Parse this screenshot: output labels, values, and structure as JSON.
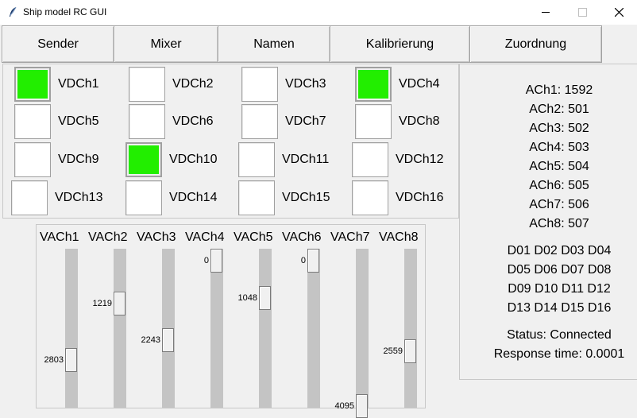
{
  "window": {
    "title": "Ship model RC GUI",
    "min": "—",
    "max": "☐",
    "close": "✕"
  },
  "menu": [
    "Sender",
    "Mixer",
    "Namen",
    "Kalibrierung",
    "Zuordnung"
  ],
  "vdch": [
    {
      "label": "VDCh1",
      "on": true
    },
    {
      "label": "VDCh2",
      "on": false
    },
    {
      "label": "VDCh3",
      "on": false
    },
    {
      "label": "VDCh4",
      "on": true
    },
    {
      "label": "VDCh5",
      "on": false
    },
    {
      "label": "VDCh6",
      "on": false
    },
    {
      "label": "VDCh7",
      "on": false
    },
    {
      "label": "VDCh8",
      "on": false
    },
    {
      "label": "VDCh9",
      "on": false
    },
    {
      "label": "VDCh10",
      "on": true
    },
    {
      "label": "VDCh11",
      "on": false
    },
    {
      "label": "VDCh12",
      "on": false
    },
    {
      "label": "VDCh13",
      "on": false
    },
    {
      "label": "VDCh14",
      "on": false
    },
    {
      "label": "VDCh15",
      "on": false
    },
    {
      "label": "VDCh16",
      "on": false
    }
  ],
  "vach": [
    {
      "label": "VACh1",
      "value": "2803"
    },
    {
      "label": "VACh2",
      "value": "1219"
    },
    {
      "label": "VACh3",
      "value": "2243"
    },
    {
      "label": "VACh4",
      "value": "0"
    },
    {
      "label": "VACh5",
      "value": "1048"
    },
    {
      "label": "VACh6",
      "value": "0"
    },
    {
      "label": "VACh7",
      "value": "4095"
    },
    {
      "label": "VACh8",
      "value": "2559"
    }
  ],
  "ach": [
    "ACh1: 1592",
    "ACh2: 501",
    "ACh3: 502",
    "ACh4: 503",
    "ACh5: 504",
    "ACh6: 505",
    "ACh7: 506",
    "ACh8: 507"
  ],
  "digital_rows": [
    "D01 D02 D03 D04",
    "D05 D06 D07 D08",
    "D09 D10 D11 D12",
    "D13 D14 D15 D16"
  ],
  "status": "Status: Connected",
  "response": "Response time: 0.0001"
}
